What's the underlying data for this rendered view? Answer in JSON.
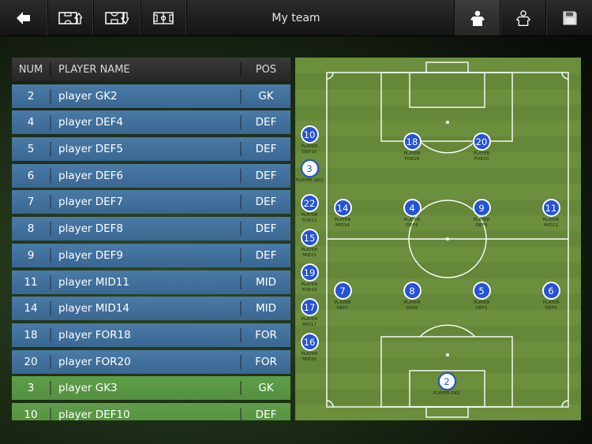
{
  "toolbar": {
    "title": "My team",
    "buttons": [
      {
        "name": "back-button",
        "icon": "back-arrow-icon"
      },
      {
        "name": "formation-up-button",
        "icon": "pitch-arrow-up-icon"
      },
      {
        "name": "formation-down-button",
        "icon": "pitch-arrow-down-icon"
      },
      {
        "name": "field-view-button",
        "icon": "field-icon"
      },
      {
        "name": "player-filled-button",
        "icon": "player-shirt-filled-icon",
        "active": true
      },
      {
        "name": "player-outline-button",
        "icon": "player-shirt-outline-icon"
      },
      {
        "name": "save-button",
        "icon": "floppy-disk-icon"
      }
    ]
  },
  "table": {
    "headers": {
      "num": "NUM",
      "name": "PLAYER NAME",
      "pos": "POS"
    },
    "rows": [
      {
        "num": "2",
        "name": "player GK2",
        "pos": "GK",
        "status": "starter"
      },
      {
        "num": "4",
        "name": "player DEF4",
        "pos": "DEF",
        "status": "starter"
      },
      {
        "num": "5",
        "name": "player DEF5",
        "pos": "DEF",
        "status": "starter"
      },
      {
        "num": "6",
        "name": "player DEF6",
        "pos": "DEF",
        "status": "starter"
      },
      {
        "num": "7",
        "name": "player DEF7",
        "pos": "DEF",
        "status": "starter"
      },
      {
        "num": "8",
        "name": "player DEF8",
        "pos": "DEF",
        "status": "starter"
      },
      {
        "num": "9",
        "name": "player DEF9",
        "pos": "DEF",
        "status": "starter"
      },
      {
        "num": "11",
        "name": "player MID11",
        "pos": "MID",
        "status": "starter"
      },
      {
        "num": "14",
        "name": "player MID14",
        "pos": "MID",
        "status": "starter"
      },
      {
        "num": "18",
        "name": "player FOR18",
        "pos": "FOR",
        "status": "starter"
      },
      {
        "num": "20",
        "name": "player FOR20",
        "pos": "FOR",
        "status": "starter"
      },
      {
        "num": "3",
        "name": "player GK3",
        "pos": "GK",
        "status": "sub"
      },
      {
        "num": "10",
        "name": "player DEF10",
        "pos": "DEF",
        "status": "sub"
      }
    ]
  },
  "colors": {
    "starter_row": "#4272a0",
    "sub_row": "#5a9846",
    "pitch": "#6a8e3d",
    "token": "#2653d6"
  },
  "pitch": {
    "bench": [
      {
        "num": "10",
        "label": "PLAYER\nDEF10"
      },
      {
        "num": "3",
        "label": "PLAYER GK3",
        "selected": true
      },
      {
        "num": "22",
        "label": "PLAYER\nFOR22"
      },
      {
        "num": "15",
        "label": "PLAYER\nMID15"
      },
      {
        "num": "19",
        "label": "PLAYER\nFOR19"
      },
      {
        "num": "17",
        "label": "PLAYER\nMID17"
      },
      {
        "num": "16",
        "label": "PLAYER\nMID16"
      }
    ],
    "field": [
      {
        "num": "18",
        "label": "PLAYER\nFOR18"
      },
      {
        "num": "20",
        "label": "PLAYER\nFOR20"
      },
      {
        "num": "14",
        "label": "PLAYER\nMID14"
      },
      {
        "num": "4",
        "label": "PLAYER\nDEF4"
      },
      {
        "num": "9",
        "label": "PLAYER\nDEF9"
      },
      {
        "num": "11",
        "label": "PLAYER\nMID11"
      },
      {
        "num": "7",
        "label": "PLAYER\nDEF7"
      },
      {
        "num": "8",
        "label": "PLAYER\nDEF8"
      },
      {
        "num": "5",
        "label": "PLAYER\nDEF5"
      },
      {
        "num": "6",
        "label": "PLAYER\nDEF6"
      },
      {
        "num": "2",
        "label": "PLAYER GK2",
        "selected": true
      }
    ]
  }
}
